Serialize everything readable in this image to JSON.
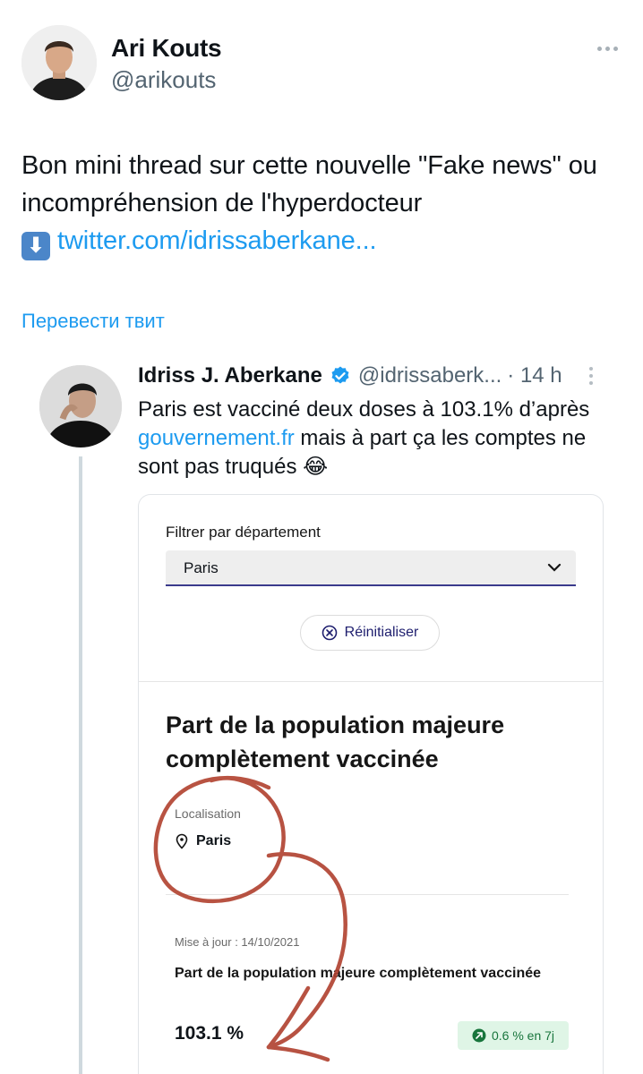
{
  "tweet": {
    "author_name": "Ari Kouts",
    "author_handle": "@arikouts",
    "text": "Bon mini thread sur cette nouvelle \"Fake news\" ou incompréhension de l'hyperdocteur",
    "emoji": "⬇",
    "link": "twitter.com/idrissaberkane...",
    "translate": "Перевести твит"
  },
  "quoted": {
    "author_name": "Idriss J. Aberkane",
    "author_handle": "@idrissaberk...",
    "time": "· 14 h",
    "text_before": "Paris est vacciné deux doses à 103.1% d’après ",
    "link": "gouvernement.fr",
    "text_after": " mais à part ça les comptes ne sont pas truqués 😂"
  },
  "screenshot": {
    "filter_label": "Filtrer par département",
    "filter_value": "Paris",
    "reset_label": "Réinitialiser",
    "section_title": "Part de la population majeure complètement vaccinée",
    "location_label": "Localisation",
    "location_value": "Paris",
    "update_label": "Mise à jour : 14/10/2021",
    "stat_title": "Part de la population majeure complètement vaccinée",
    "stat_value": "103.1 %",
    "badge_text": "0.6 % en 7j"
  },
  "icons": {
    "more": "more-horizontal-icon",
    "verified": "verified-badge-icon",
    "chevron": "chevron-down-icon",
    "reset": "close-circle-icon",
    "pin": "map-pin-icon",
    "trend": "trend-up-icon"
  },
  "colors": {
    "link": "#1d9bf0",
    "verified": "#1d9bf0",
    "annotation": "#b0402e",
    "badge_bg": "#dff5e6",
    "badge_text": "#18753c"
  }
}
